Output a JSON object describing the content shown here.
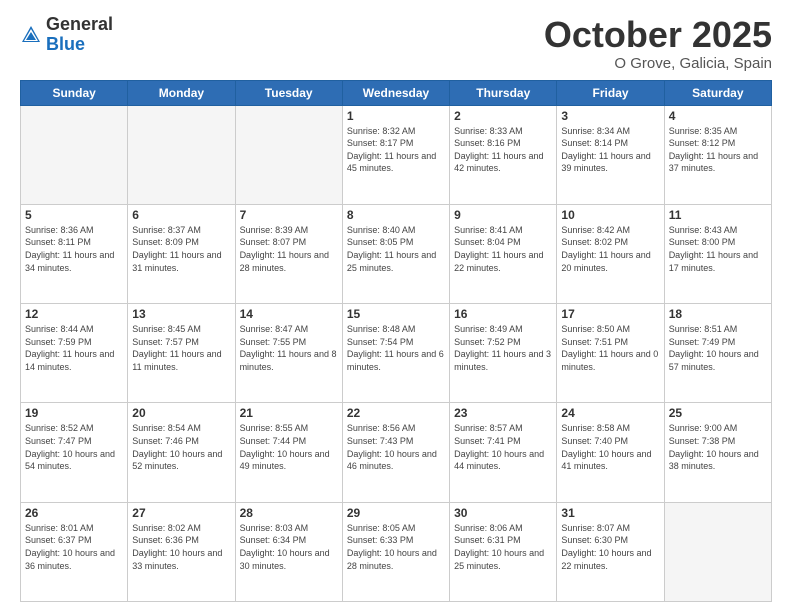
{
  "header": {
    "logo_general": "General",
    "logo_blue": "Blue",
    "title": "October 2025",
    "location": "O Grove, Galicia, Spain"
  },
  "weekdays": [
    "Sunday",
    "Monday",
    "Tuesday",
    "Wednesday",
    "Thursday",
    "Friday",
    "Saturday"
  ],
  "weeks": [
    [
      {
        "day": "",
        "sunrise": "",
        "sunset": "",
        "daylight": "",
        "empty": true
      },
      {
        "day": "",
        "sunrise": "",
        "sunset": "",
        "daylight": "",
        "empty": true
      },
      {
        "day": "",
        "sunrise": "",
        "sunset": "",
        "daylight": "",
        "empty": true
      },
      {
        "day": "1",
        "sunrise": "Sunrise: 8:32 AM",
        "sunset": "Sunset: 8:17 PM",
        "daylight": "Daylight: 11 hours and 45 minutes.",
        "empty": false
      },
      {
        "day": "2",
        "sunrise": "Sunrise: 8:33 AM",
        "sunset": "Sunset: 8:16 PM",
        "daylight": "Daylight: 11 hours and 42 minutes.",
        "empty": false
      },
      {
        "day": "3",
        "sunrise": "Sunrise: 8:34 AM",
        "sunset": "Sunset: 8:14 PM",
        "daylight": "Daylight: 11 hours and 39 minutes.",
        "empty": false
      },
      {
        "day": "4",
        "sunrise": "Sunrise: 8:35 AM",
        "sunset": "Sunset: 8:12 PM",
        "daylight": "Daylight: 11 hours and 37 minutes.",
        "empty": false
      }
    ],
    [
      {
        "day": "5",
        "sunrise": "Sunrise: 8:36 AM",
        "sunset": "Sunset: 8:11 PM",
        "daylight": "Daylight: 11 hours and 34 minutes.",
        "empty": false
      },
      {
        "day": "6",
        "sunrise": "Sunrise: 8:37 AM",
        "sunset": "Sunset: 8:09 PM",
        "daylight": "Daylight: 11 hours and 31 minutes.",
        "empty": false
      },
      {
        "day": "7",
        "sunrise": "Sunrise: 8:39 AM",
        "sunset": "Sunset: 8:07 PM",
        "daylight": "Daylight: 11 hours and 28 minutes.",
        "empty": false
      },
      {
        "day": "8",
        "sunrise": "Sunrise: 8:40 AM",
        "sunset": "Sunset: 8:05 PM",
        "daylight": "Daylight: 11 hours and 25 minutes.",
        "empty": false
      },
      {
        "day": "9",
        "sunrise": "Sunrise: 8:41 AM",
        "sunset": "Sunset: 8:04 PM",
        "daylight": "Daylight: 11 hours and 22 minutes.",
        "empty": false
      },
      {
        "day": "10",
        "sunrise": "Sunrise: 8:42 AM",
        "sunset": "Sunset: 8:02 PM",
        "daylight": "Daylight: 11 hours and 20 minutes.",
        "empty": false
      },
      {
        "day": "11",
        "sunrise": "Sunrise: 8:43 AM",
        "sunset": "Sunset: 8:00 PM",
        "daylight": "Daylight: 11 hours and 17 minutes.",
        "empty": false
      }
    ],
    [
      {
        "day": "12",
        "sunrise": "Sunrise: 8:44 AM",
        "sunset": "Sunset: 7:59 PM",
        "daylight": "Daylight: 11 hours and 14 minutes.",
        "empty": false
      },
      {
        "day": "13",
        "sunrise": "Sunrise: 8:45 AM",
        "sunset": "Sunset: 7:57 PM",
        "daylight": "Daylight: 11 hours and 11 minutes.",
        "empty": false
      },
      {
        "day": "14",
        "sunrise": "Sunrise: 8:47 AM",
        "sunset": "Sunset: 7:55 PM",
        "daylight": "Daylight: 11 hours and 8 minutes.",
        "empty": false
      },
      {
        "day": "15",
        "sunrise": "Sunrise: 8:48 AM",
        "sunset": "Sunset: 7:54 PM",
        "daylight": "Daylight: 11 hours and 6 minutes.",
        "empty": false
      },
      {
        "day": "16",
        "sunrise": "Sunrise: 8:49 AM",
        "sunset": "Sunset: 7:52 PM",
        "daylight": "Daylight: 11 hours and 3 minutes.",
        "empty": false
      },
      {
        "day": "17",
        "sunrise": "Sunrise: 8:50 AM",
        "sunset": "Sunset: 7:51 PM",
        "daylight": "Daylight: 11 hours and 0 minutes.",
        "empty": false
      },
      {
        "day": "18",
        "sunrise": "Sunrise: 8:51 AM",
        "sunset": "Sunset: 7:49 PM",
        "daylight": "Daylight: 10 hours and 57 minutes.",
        "empty": false
      }
    ],
    [
      {
        "day": "19",
        "sunrise": "Sunrise: 8:52 AM",
        "sunset": "Sunset: 7:47 PM",
        "daylight": "Daylight: 10 hours and 54 minutes.",
        "empty": false
      },
      {
        "day": "20",
        "sunrise": "Sunrise: 8:54 AM",
        "sunset": "Sunset: 7:46 PM",
        "daylight": "Daylight: 10 hours and 52 minutes.",
        "empty": false
      },
      {
        "day": "21",
        "sunrise": "Sunrise: 8:55 AM",
        "sunset": "Sunset: 7:44 PM",
        "daylight": "Daylight: 10 hours and 49 minutes.",
        "empty": false
      },
      {
        "day": "22",
        "sunrise": "Sunrise: 8:56 AM",
        "sunset": "Sunset: 7:43 PM",
        "daylight": "Daylight: 10 hours and 46 minutes.",
        "empty": false
      },
      {
        "day": "23",
        "sunrise": "Sunrise: 8:57 AM",
        "sunset": "Sunset: 7:41 PM",
        "daylight": "Daylight: 10 hours and 44 minutes.",
        "empty": false
      },
      {
        "day": "24",
        "sunrise": "Sunrise: 8:58 AM",
        "sunset": "Sunset: 7:40 PM",
        "daylight": "Daylight: 10 hours and 41 minutes.",
        "empty": false
      },
      {
        "day": "25",
        "sunrise": "Sunrise: 9:00 AM",
        "sunset": "Sunset: 7:38 PM",
        "daylight": "Daylight: 10 hours and 38 minutes.",
        "empty": false
      }
    ],
    [
      {
        "day": "26",
        "sunrise": "Sunrise: 8:01 AM",
        "sunset": "Sunset: 6:37 PM",
        "daylight": "Daylight: 10 hours and 36 minutes.",
        "empty": false
      },
      {
        "day": "27",
        "sunrise": "Sunrise: 8:02 AM",
        "sunset": "Sunset: 6:36 PM",
        "daylight": "Daylight: 10 hours and 33 minutes.",
        "empty": false
      },
      {
        "day": "28",
        "sunrise": "Sunrise: 8:03 AM",
        "sunset": "Sunset: 6:34 PM",
        "daylight": "Daylight: 10 hours and 30 minutes.",
        "empty": false
      },
      {
        "day": "29",
        "sunrise": "Sunrise: 8:05 AM",
        "sunset": "Sunset: 6:33 PM",
        "daylight": "Daylight: 10 hours and 28 minutes.",
        "empty": false
      },
      {
        "day": "30",
        "sunrise": "Sunrise: 8:06 AM",
        "sunset": "Sunset: 6:31 PM",
        "daylight": "Daylight: 10 hours and 25 minutes.",
        "empty": false
      },
      {
        "day": "31",
        "sunrise": "Sunrise: 8:07 AM",
        "sunset": "Sunset: 6:30 PM",
        "daylight": "Daylight: 10 hours and 22 minutes.",
        "empty": false
      },
      {
        "day": "",
        "sunrise": "",
        "sunset": "",
        "daylight": "",
        "empty": true
      }
    ]
  ]
}
